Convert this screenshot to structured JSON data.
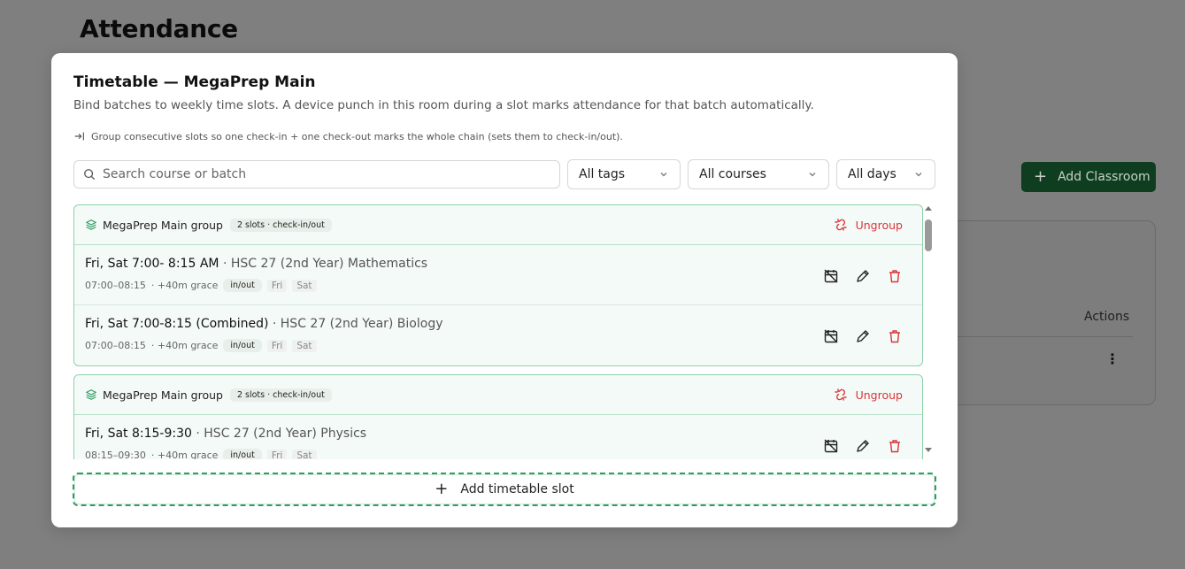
{
  "background": {
    "title": "Attendance",
    "add_button": "Add Classroom",
    "actions_header": "Actions"
  },
  "modal": {
    "title": "Timetable — MegaPrep Main",
    "subtitle": "Bind batches to weekly time slots. A device punch in this room during a slot marks attendance for that batch automatically.",
    "hint": "Group consecutive slots so one check-in + one check-out marks the whole chain (sets them to check-in/out).",
    "search_placeholder": "Search course or batch",
    "filters": {
      "tags": "All tags",
      "courses": "All courses",
      "days": "All days"
    },
    "groups": [
      {
        "name": "MegaPrep Main group",
        "badge": "2 slots · check-in/out",
        "ungroup_label": "Ungroup",
        "slots": [
          {
            "title": "Fri, Sat 7:00- 8:15 AM",
            "course": "· HSC 27 (2nd Year) Mathematics",
            "time": "07:00–08:15",
            "grace": "· +40m grace",
            "mode": "in/out",
            "days": [
              "Fri",
              "Sat"
            ]
          },
          {
            "title": "Fri, Sat 7:00-8:15 (Combined)",
            "course": "· HSC 27 (2nd Year) Biology",
            "time": "07:00–08:15",
            "grace": "· +40m grace",
            "mode": "in/out",
            "days": [
              "Fri",
              "Sat"
            ]
          }
        ]
      },
      {
        "name": "MegaPrep Main group",
        "badge": "2 slots · check-in/out",
        "ungroup_label": "Ungroup",
        "slots": [
          {
            "title": "Fri, Sat 8:15-9:30",
            "course": "· HSC 27 (2nd Year) Physics",
            "time": "08:15–09:30",
            "grace": "· +40m grace",
            "mode": "in/out",
            "days": [
              "Fri",
              "Sat"
            ]
          }
        ]
      }
    ],
    "add_slot_label": "Add timetable slot"
  },
  "colors": {
    "accent_green": "#2f9d63",
    "danger_red": "#d8363a",
    "dark_green_button": "#0e3d1f"
  }
}
